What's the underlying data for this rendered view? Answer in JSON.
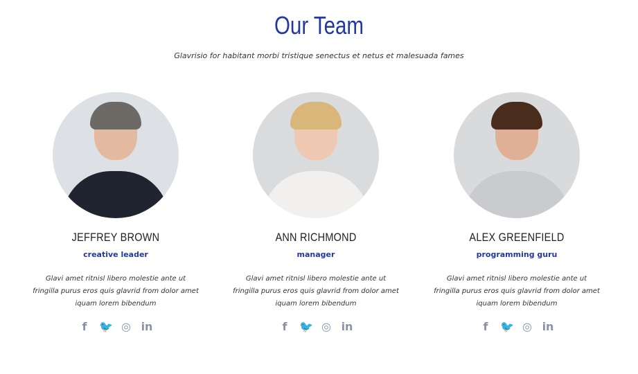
{
  "header": {
    "title": "Our Team",
    "subtitle": "Glavrisio for habitant morbi tristique senectus et netus et malesuada fames"
  },
  "members": [
    {
      "name": "JEFFREY BROWN",
      "role": "creative leader",
      "description": "Glavi amet ritnisl libero molestie ante ut fringilla purus eros quis glavrid from dolor amet iquam lorem bibendum",
      "colors": {
        "hair": "#6d6a66",
        "skin": "#e3b9a0",
        "body": "#1f2430",
        "bg": "#dde1e6"
      }
    },
    {
      "name": "ANN RICHMOND",
      "role": "manager",
      "description": "Glavi amet ritnisl libero molestie ante ut fringilla purus eros quis glavrid from dolor amet iquam lorem bibendum",
      "colors": {
        "hair": "#d9b679",
        "skin": "#efc8b2",
        "body": "#f2f0ee",
        "bg": "#dadbdd"
      }
    },
    {
      "name": "ALEX GREENFIELD",
      "role": "programming guru",
      "description": "Glavi amet ritnisl libero molestie ante ut fringilla purus eros quis glavrid from dolor amet iquam lorem bibendum",
      "colors": {
        "hair": "#4a2c1d",
        "skin": "#e0b096",
        "body": "#c9cbce",
        "bg": "#d9dadc"
      }
    }
  ],
  "social_icons": [
    {
      "icon": "facebook-icon",
      "glyph": "f"
    },
    {
      "icon": "twitter-icon",
      "glyph": "🐦"
    },
    {
      "icon": "instagram-icon",
      "glyph": "◎"
    },
    {
      "icon": "linkedin-icon",
      "glyph": "in"
    }
  ],
  "accent": "#2238a0"
}
